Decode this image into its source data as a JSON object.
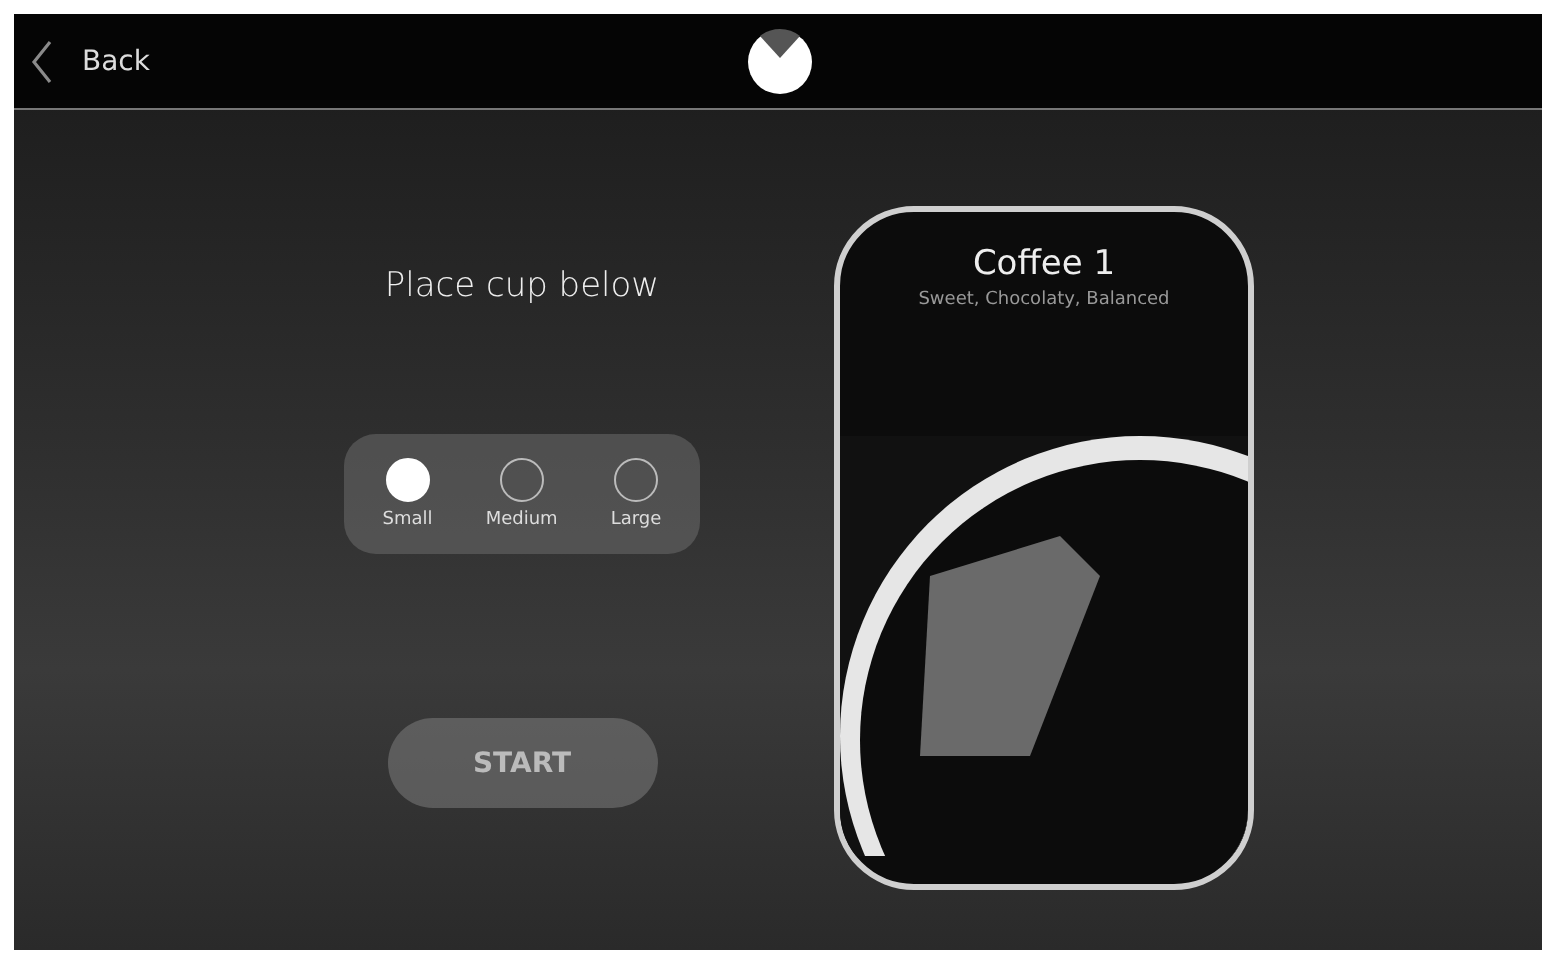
{
  "header": {
    "back_label": "Back"
  },
  "prompt": "Place cup below",
  "sizes": [
    {
      "label": "Small",
      "selected": true
    },
    {
      "label": "Medium",
      "selected": false
    },
    {
      "label": "Large",
      "selected": false
    }
  ],
  "start_button": "START",
  "drink_card": {
    "title": "Coffee 1",
    "subtitle": "Sweet, Chocolaty, Balanced"
  }
}
